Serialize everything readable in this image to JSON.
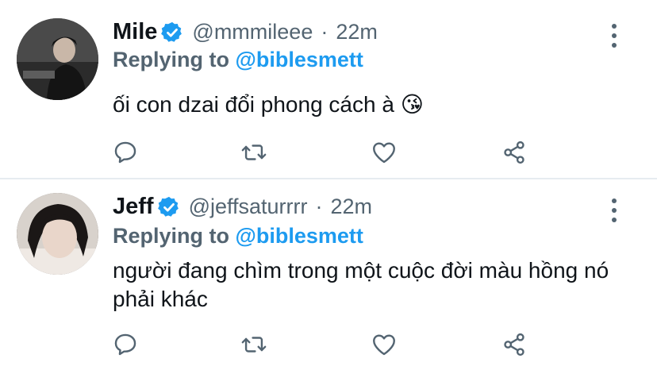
{
  "colors": {
    "accent": "#1d9bf0",
    "secondary_text": "#536471",
    "primary_text": "#0f1419",
    "divider": "#e6ecf0"
  },
  "tweets": [
    {
      "name": "Mile",
      "handle": "@mmmileee",
      "separator": "·",
      "time": "22m",
      "reply_prefix": "Replying to",
      "reply_mention": "@biblesmett",
      "text": "ối con dzai đổi phong cách à 😘",
      "verified": true
    },
    {
      "name": "Jeff",
      "handle": "@jeffsaturrrr",
      "separator": "·",
      "time": "22m",
      "reply_prefix": "Replying to",
      "reply_mention": "@biblesmett",
      "text": "người đang chìm trong một cuộc đời màu hồng nó phải khác",
      "verified": true
    }
  ],
  "icons": {
    "verified": "verified-badge-icon",
    "more": "more-options-icon",
    "reply": "reply-icon",
    "retweet": "retweet-icon",
    "like": "like-icon",
    "share": "share-icon"
  }
}
